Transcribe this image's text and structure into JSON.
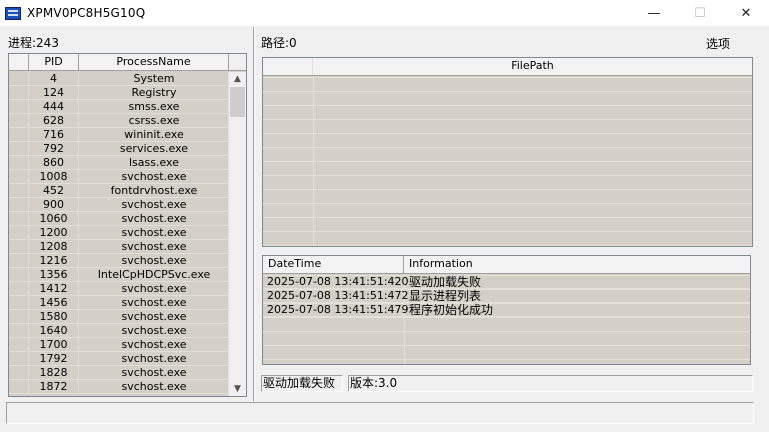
{
  "window": {
    "title": "XPMV0PC8H5G10Q",
    "minimize": "—",
    "maximize": "☐",
    "close": "✕"
  },
  "left": {
    "process_count_label": "进程:243",
    "headers": {
      "pid": "PID",
      "name": "ProcessName"
    },
    "processes": [
      {
        "pid": "4",
        "name": "System"
      },
      {
        "pid": "124",
        "name": "Registry"
      },
      {
        "pid": "444",
        "name": "smss.exe"
      },
      {
        "pid": "628",
        "name": "csrss.exe"
      },
      {
        "pid": "716",
        "name": "wininit.exe"
      },
      {
        "pid": "792",
        "name": "services.exe"
      },
      {
        "pid": "860",
        "name": "lsass.exe"
      },
      {
        "pid": "1008",
        "name": "svchost.exe"
      },
      {
        "pid": "452",
        "name": "fontdrvhost.exe"
      },
      {
        "pid": "900",
        "name": "svchost.exe"
      },
      {
        "pid": "1060",
        "name": "svchost.exe"
      },
      {
        "pid": "1200",
        "name": "svchost.exe"
      },
      {
        "pid": "1208",
        "name": "svchost.exe"
      },
      {
        "pid": "1216",
        "name": "svchost.exe"
      },
      {
        "pid": "1356",
        "name": "IntelCpHDCPSvc.exe"
      },
      {
        "pid": "1412",
        "name": "svchost.exe"
      },
      {
        "pid": "1456",
        "name": "svchost.exe"
      },
      {
        "pid": "1580",
        "name": "svchost.exe"
      },
      {
        "pid": "1640",
        "name": "svchost.exe"
      },
      {
        "pid": "1700",
        "name": "svchost.exe"
      },
      {
        "pid": "1792",
        "name": "svchost.exe"
      },
      {
        "pid": "1828",
        "name": "svchost.exe"
      },
      {
        "pid": "1872",
        "name": "svchost.exe"
      }
    ],
    "scroll_up": "▲",
    "scroll_down": "▼"
  },
  "right": {
    "path_label": "路径:0",
    "options_label": "选项",
    "filepath_header": "FilePath",
    "log_headers": {
      "datetime": "DateTime",
      "info": "Information"
    },
    "logs": [
      {
        "datetime": "2025-07-08 13:41:51:420",
        "info": "驱动加载失败"
      },
      {
        "datetime": "2025-07-08 13:41:51:472",
        "info": "显示进程列表"
      },
      {
        "datetime": "2025-07-08 13:41:51:479",
        "info": "程序初始化成功"
      }
    ],
    "status_driver": "驱动加载失败",
    "status_version": "版本:3.0"
  }
}
